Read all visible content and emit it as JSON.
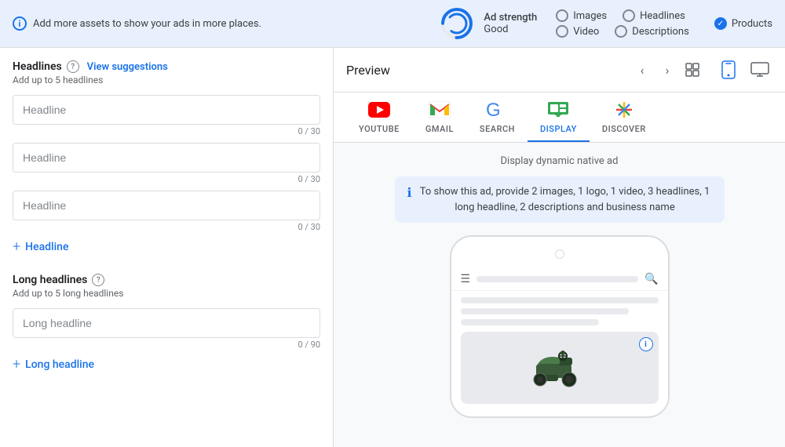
{
  "topBar": {
    "infoText": "Add more assets to show your ads in more places.",
    "adStrength": {
      "label": "Ad strength",
      "helpTooltip": "Ad strength",
      "value": "Good"
    },
    "navOptions": {
      "row1": [
        {
          "id": "images",
          "label": "Images",
          "checked": false
        },
        {
          "id": "headlines",
          "label": "Headlines",
          "checked": false
        }
      ],
      "row2": [
        {
          "id": "video",
          "label": "Video",
          "checked": false
        },
        {
          "id": "descriptions",
          "label": "Descriptions",
          "checked": false
        }
      ],
      "products": {
        "id": "products",
        "label": "Products",
        "checked": true
      }
    }
  },
  "leftPanel": {
    "headlines": {
      "title": "Headlines",
      "subtitle": "Add up to 5 headlines",
      "viewSuggestionsLabel": "View suggestions",
      "fields": [
        {
          "placeholder": "Headline",
          "charCount": "0 / 30"
        },
        {
          "placeholder": "Headline",
          "charCount": "0 / 30"
        },
        {
          "placeholder": "Headline",
          "charCount": "0 / 30"
        }
      ],
      "addLabel": "Headline"
    },
    "longHeadlines": {
      "title": "Long headlines",
      "subtitle": "Add up to 5 long headlines",
      "fields": [
        {
          "placeholder": "Long headline",
          "charCount": "0 / 90"
        }
      ],
      "addLabel": "Long headline"
    }
  },
  "rightPanel": {
    "previewTitle": "Preview",
    "platformTabs": [
      {
        "id": "youtube",
        "label": "YOUTUBE",
        "active": false
      },
      {
        "id": "gmail",
        "label": "GMAIL",
        "active": false
      },
      {
        "id": "search",
        "label": "SEARCH",
        "active": false
      },
      {
        "id": "display",
        "label": "DISPLAY",
        "active": true
      },
      {
        "id": "discover",
        "label": "DISCOVER",
        "active": false
      }
    ],
    "adTypeLabel": "Display dynamic native ad",
    "infoBanner": "To show this ad, provide 2 images, 1 logo, 1 video, 3 headlines, 1 long headline, 2 descriptions and business name"
  }
}
